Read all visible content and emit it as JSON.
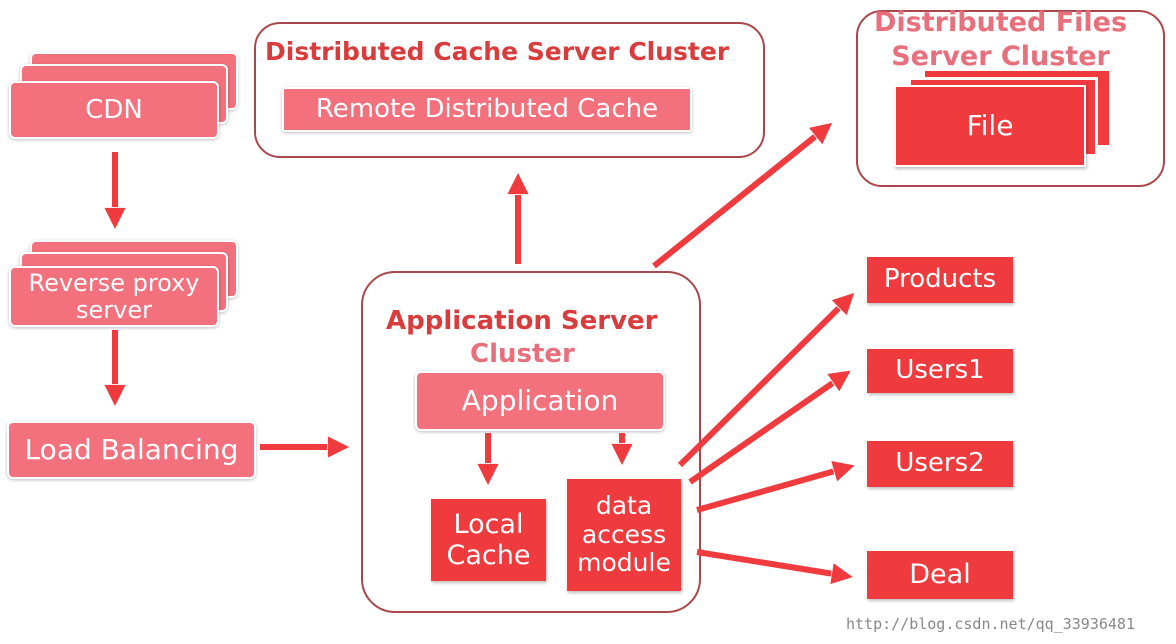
{
  "nodes": {
    "cdn": "CDN",
    "reverse_proxy": "Reverse proxy server",
    "load_balancing": "Load Balancing",
    "cache_cluster_title": "Distributed Cache Server Cluster",
    "remote_cache": "Remote Distributed Cache",
    "files_cluster_title_line1": "Distributed Files",
    "files_cluster_title_line2": "Server Cluster",
    "file": "File",
    "app_cluster_title_line1": "Application Server",
    "app_cluster_title_line2": "Cluster",
    "application": "Application",
    "local_cache": "Local Cache",
    "data_access_module": "data access module",
    "products": "Products",
    "users1": "Users1",
    "users2": "Users2",
    "deal": "Deal"
  },
  "watermark": "http://blog.csdn.net/qq_33936481",
  "colors": {
    "pink": "#f3707d",
    "red": "#ef3a3e",
    "title": "#d93c3c",
    "border": "#a9474c"
  }
}
